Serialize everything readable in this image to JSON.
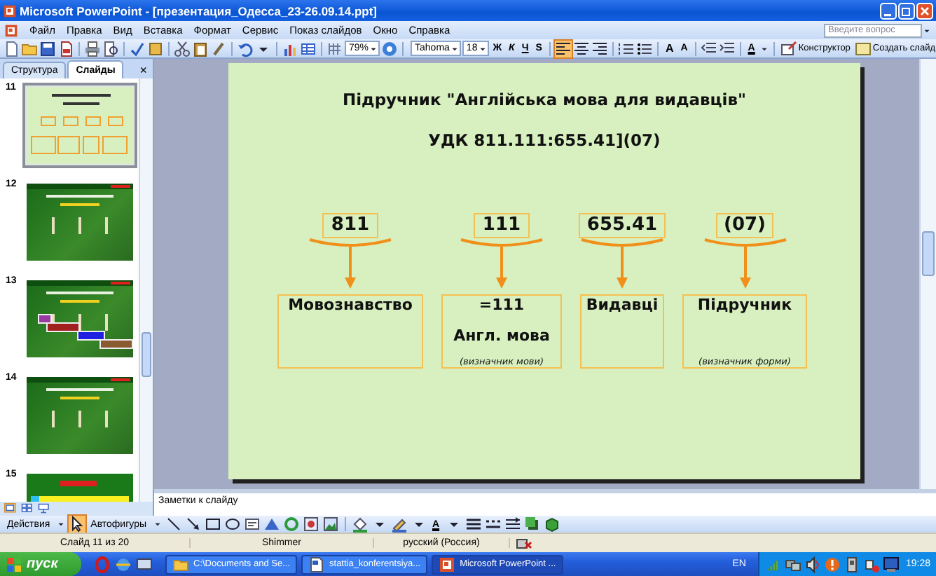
{
  "window": {
    "title": "Microsoft PowerPoint - [презентация_Одесса_23-26.09.14.ppt]"
  },
  "menu": [
    "Файл",
    "Правка",
    "Вид",
    "Вставка",
    "Формат",
    "Сервис",
    "Показ слайдов",
    "Окно",
    "Справка"
  ],
  "help_search": {
    "placeholder": "Введите вопрос"
  },
  "toolbar": {
    "zoom": "79%",
    "font": "Tahoma",
    "font_size": "18",
    "style_buttons": [
      "Ж",
      "К",
      "Ч",
      "S"
    ],
    "alignment": [
      {
        "selected": true
      },
      {
        "selected": false
      },
      {
        "selected": false
      }
    ],
    "font_size_buttons": [
      "A",
      "A"
    ],
    "font_color": "A",
    "design_button": "Конструктор",
    "new_slide_button": "Создать слайд"
  },
  "side_pane": {
    "tabs": [
      {
        "label": "Структура",
        "selected": false
      },
      {
        "label": "Слайды",
        "selected": true
      }
    ],
    "close": "×",
    "thumbnails": [
      {
        "number": "11",
        "selected": true,
        "kind": "light"
      },
      {
        "number": "12",
        "selected": false,
        "kind": "dark"
      },
      {
        "number": "13",
        "selected": false,
        "kind": "colored"
      },
      {
        "number": "14",
        "selected": false,
        "kind": "dark"
      },
      {
        "number": "15",
        "selected": false,
        "kind": "table"
      }
    ]
  },
  "slide": {
    "title": "Підручник \"Англійська мова для видавців\"",
    "udc": "УДК 811.111:655.41](07)",
    "parts": [
      {
        "code": "811",
        "lines": [
          {
            "text": "Мовознавство",
            "kind": "main"
          }
        ]
      },
      {
        "code": "111",
        "lines": [
          {
            "text": "=111",
            "kind": "main"
          },
          {
            "text": "Англ. мова",
            "kind": "main"
          },
          {
            "text": "(визначник мови)",
            "kind": "note"
          }
        ]
      },
      {
        "code": "655.41",
        "lines": [
          {
            "text": "Видавці",
            "kind": "main"
          }
        ]
      },
      {
        "code": "(07)",
        "lines": [
          {
            "text": "Підручник",
            "kind": "main"
          },
          {
            "text": "(визначник форми)",
            "kind": "note"
          }
        ]
      }
    ]
  },
  "notes": {
    "placeholder": "Заметки к слайду"
  },
  "drawing_toolbar": {
    "actions": "Действия",
    "autoshapes": "Автофигуры",
    "font_color": "A"
  },
  "status_bar": [
    "Слайд 11 из 20",
    "Shimmer",
    "русский (Россия)"
  ],
  "taskbar": {
    "start": "пуск",
    "windows": [
      {
        "label": "C:\\Documents and Se...",
        "selected": false,
        "kind": "folder"
      },
      {
        "label": "stattia_konferentsiya...",
        "selected": false,
        "kind": "document"
      },
      {
        "label": "Microsoft PowerPoint ...",
        "selected": true,
        "kind": "powerpoint"
      }
    ],
    "language": "EN",
    "clock": "19:28"
  }
}
